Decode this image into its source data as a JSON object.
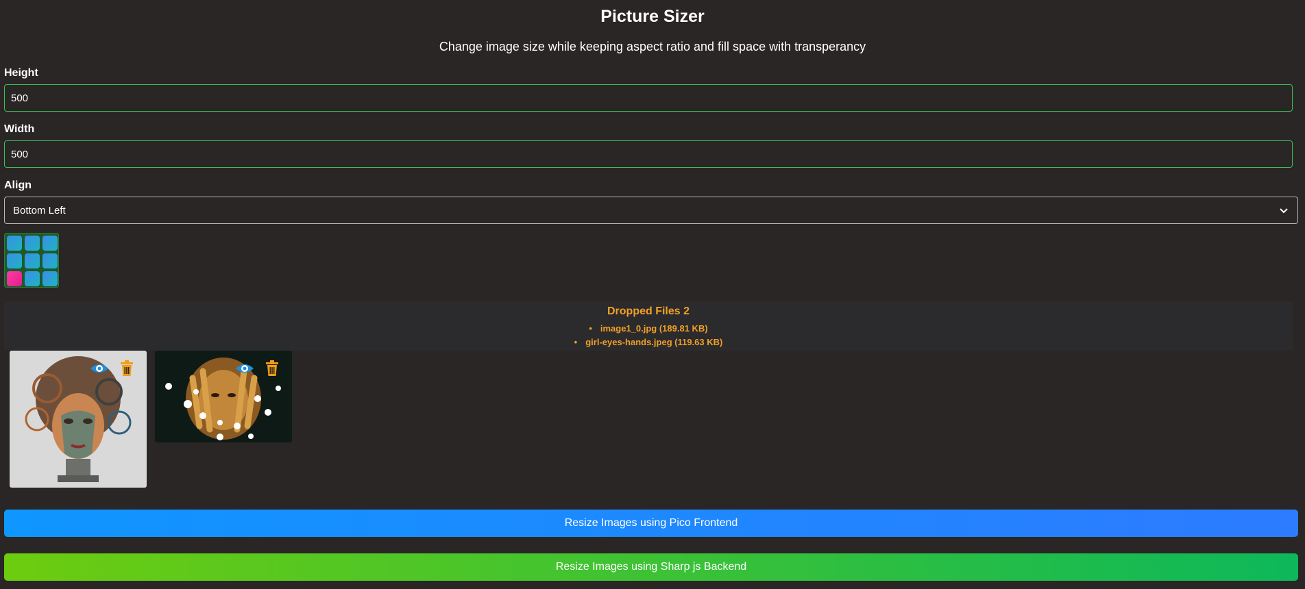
{
  "header": {
    "title": "Picture Sizer",
    "subtitle": "Change image size while keeping aspect ratio and fill space with transperancy"
  },
  "form": {
    "height_label": "Height",
    "height_value": "500",
    "width_label": "Width",
    "width_value": "500",
    "align_label": "Align",
    "align_value": "Bottom Left",
    "align_selected_cell": "bottom-left"
  },
  "dropzone": {
    "title": "Dropped Files 2",
    "files": [
      "image1_0.jpg (189.81 KB)",
      "girl-eyes-hands.jpeg (119.63 KB)"
    ]
  },
  "thumbnails": [
    {
      "preview_icon": "eye-icon",
      "delete_icon": "trash-icon"
    },
    {
      "preview_icon": "eye-icon",
      "delete_icon": "trash-icon"
    }
  ],
  "buttons": {
    "pico_label": "Resize Images using Pico Frontend",
    "sharp_label": "Resize Images using Sharp js Backend"
  },
  "colors": {
    "background": "#292625",
    "input_border": "#3cbf5a",
    "accent_orange": "#f2a127",
    "selected_cell": "#ff3aa8",
    "button_blue": "#0f96ff",
    "button_green": "#6dcc0f"
  }
}
